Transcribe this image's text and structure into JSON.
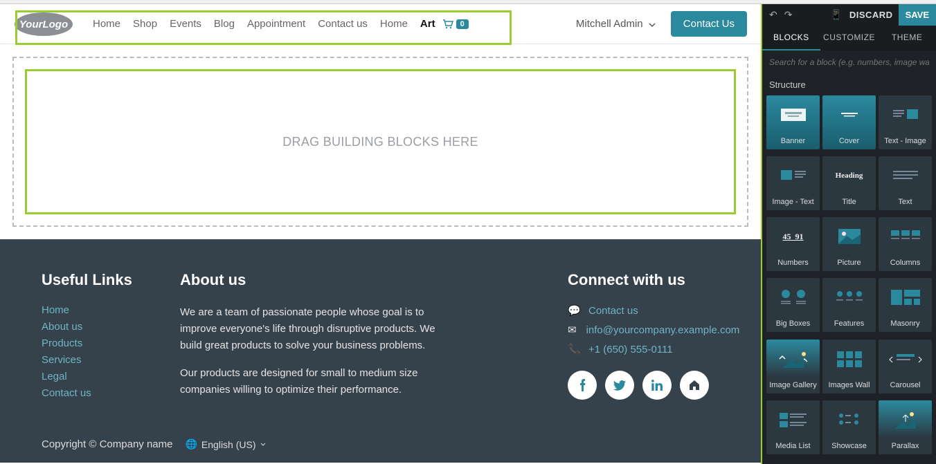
{
  "browser": {
    "url": "demo3.odoo.com/art"
  },
  "nav": {
    "items": [
      "Home",
      "Shop",
      "Events",
      "Blog",
      "Appointment",
      "Contact us",
      "Home",
      "Art"
    ],
    "active_index": 7,
    "cart_count": "0",
    "user": "Mitchell Admin",
    "contact_btn": "Contact Us"
  },
  "canvas": {
    "placeholder": "DRAG BUILDING BLOCKS HERE"
  },
  "footer": {
    "useful_links_title": "Useful Links",
    "useful_links": [
      "Home",
      "About us",
      "Products",
      "Services",
      "Legal",
      "Contact us"
    ],
    "about_title": "About us",
    "about_p1": "We are a team of passionate people whose goal is to improve everyone's life through disruptive products. We build great products to solve your business problems.",
    "about_p2": "Our products are designed for small to medium size companies willing to optimize their performance.",
    "connect_title": "Connect with us",
    "connect_contact": "Contact us",
    "connect_email": "info@yourcompany.example.com",
    "connect_phone": "+1 (650) 555-0111",
    "copyright": "Copyright © Company name",
    "language": "English (US)"
  },
  "panel": {
    "discard": "DISCARD",
    "save": "SAVE",
    "tabs": [
      "BLOCKS",
      "CUSTOMIZE",
      "THEME"
    ],
    "active_tab": 0,
    "search_placeholder": "Search for a block (e.g. numbers, image wall, ...)",
    "section": "Structure",
    "blocks": [
      {
        "name": "Banner"
      },
      {
        "name": "Cover"
      },
      {
        "name": "Text - Image"
      },
      {
        "name": "Image - Text"
      },
      {
        "name": "Title"
      },
      {
        "name": "Text"
      },
      {
        "name": "Numbers"
      },
      {
        "name": "Picture"
      },
      {
        "name": "Columns"
      },
      {
        "name": "Big Boxes"
      },
      {
        "name": "Features"
      },
      {
        "name": "Masonry"
      },
      {
        "name": "Image Gallery"
      },
      {
        "name": "Images Wall"
      },
      {
        "name": "Carousel"
      },
      {
        "name": "Media List"
      },
      {
        "name": "Showcase"
      },
      {
        "name": "Parallax"
      }
    ]
  }
}
